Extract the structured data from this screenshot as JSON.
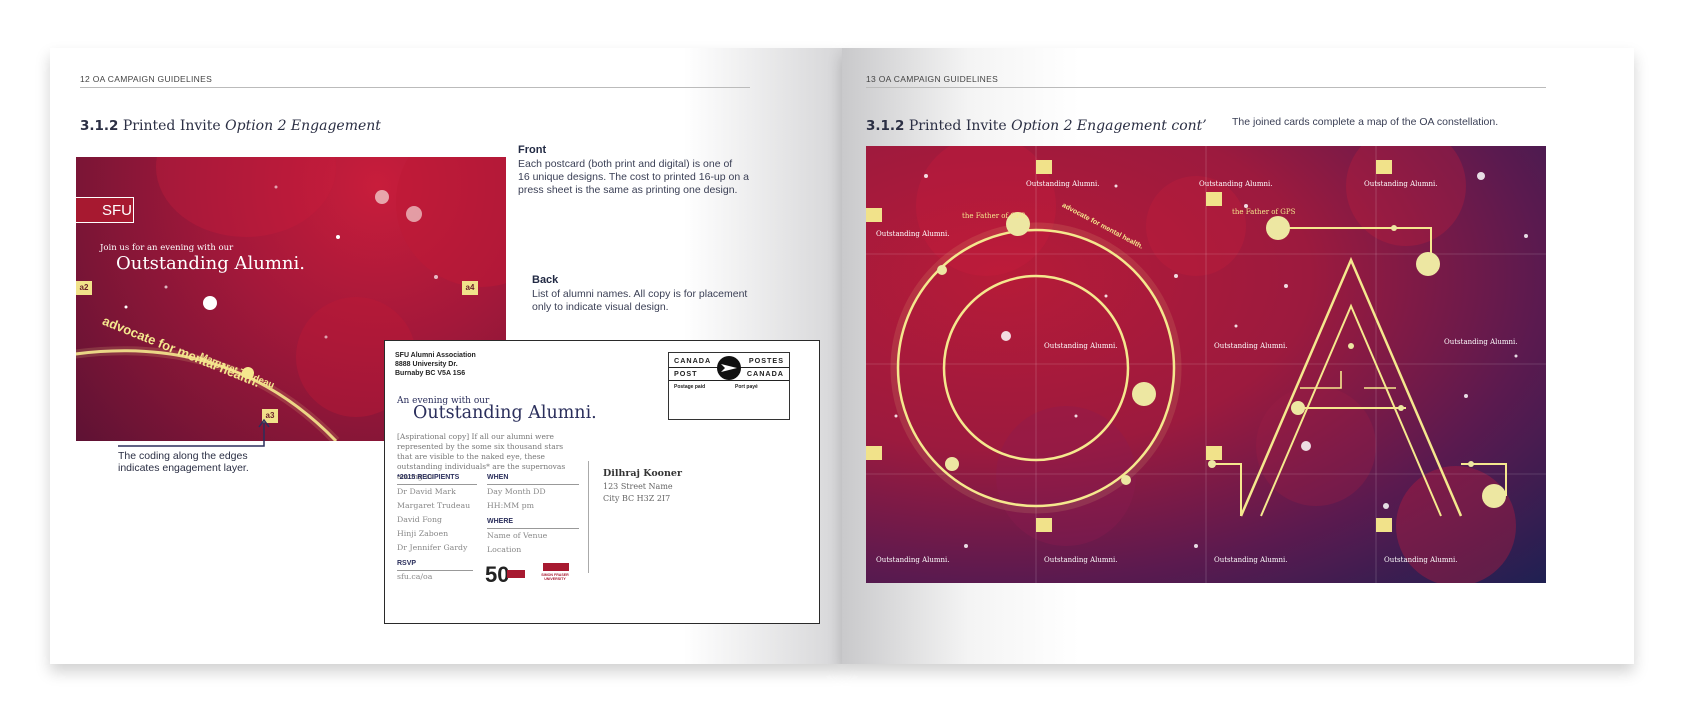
{
  "left_page": {
    "running_head": "12  OA CAMPAIGN GUIDELINES",
    "section_number": "3.1.2",
    "section_title": "Printed Invite",
    "section_option": "Option 2 Engagement",
    "front_heading": "Front",
    "front_text_lines": [
      "Each postcard (both print and digital) is one of",
      "16 unique designs. The cost to printed 16-up on a",
      "press sheet is the same as printing one design."
    ],
    "back_heading": "Back",
    "back_text_lines": [
      "List of alumni names. All copy is for placement",
      "only to indicate visual design."
    ],
    "callout_text": "The coding along the edges indicates engagement layer.",
    "card_front": {
      "logo": "SFU",
      "join_text": "Join us for an evening with our",
      "title": "Outstanding Alumni.",
      "tag_left": "a2",
      "tag_right": "a4",
      "tag_bottom": "a3",
      "alum_name": "Margaret Trudeau",
      "tagline": "advocate for mental health."
    },
    "card_back": {
      "return_lines": [
        "SFU Alumni Association",
        "8888 University Dr.",
        "Burnaby BC V5A 1S6"
      ],
      "stamp_top_left": "CANADA",
      "stamp_top_right": "POSTES",
      "stamp_mid_left": "POST",
      "stamp_mid_right": "CANADA",
      "postage_left": "Postage paid",
      "postage_right": "Port payé",
      "evening": "An evening with our",
      "title": "Outstanding Alumni.",
      "aspirational": "[Aspirational copy] If all our alumni were represented by the some six thousand stars that are visible to the naked eye, these outstanding individuals* are the supernovas among us.",
      "recipients_heading": "*2015 RECIPIENTS",
      "recipients": [
        "Dr David Mark",
        "Margaret Trudeau",
        "David Fong",
        "Hinji Zaboen",
        "Dr Jennifer Gardy"
      ],
      "when_heading": "WHEN",
      "when_lines": [
        "Day Month DD",
        "HH:MM pm"
      ],
      "where_heading": "WHERE",
      "where_lines": [
        "Name of Venue",
        "Location"
      ],
      "rsvp_heading": "RSVP",
      "rsvp_value": "sfu.ca/oa",
      "address_name": "Dilhraj Kooner",
      "address_street": "123 Street Name",
      "address_city": "City BC  H3Z 2I7",
      "anniversary_logo": "50",
      "university_logo": "SIMON FRASER UNIVERSITY"
    }
  },
  "right_page": {
    "running_head": "13  OA CAMPAIGN GUIDELINES",
    "section_number": "3.1.2",
    "section_title": "Printed Invite",
    "section_option": "Option 2 Engagement cont’",
    "caption": "The joined cards complete a map of the OA constellation.",
    "map_labels": {
      "oa": "Outstanding Alumni.",
      "gps": "the Father of GPS",
      "advocate": "advocate for mental health."
    }
  },
  "colors": {
    "crimson": "#a71930",
    "star_yellow": "#f1e28a",
    "navy": "#2b2f5c"
  }
}
